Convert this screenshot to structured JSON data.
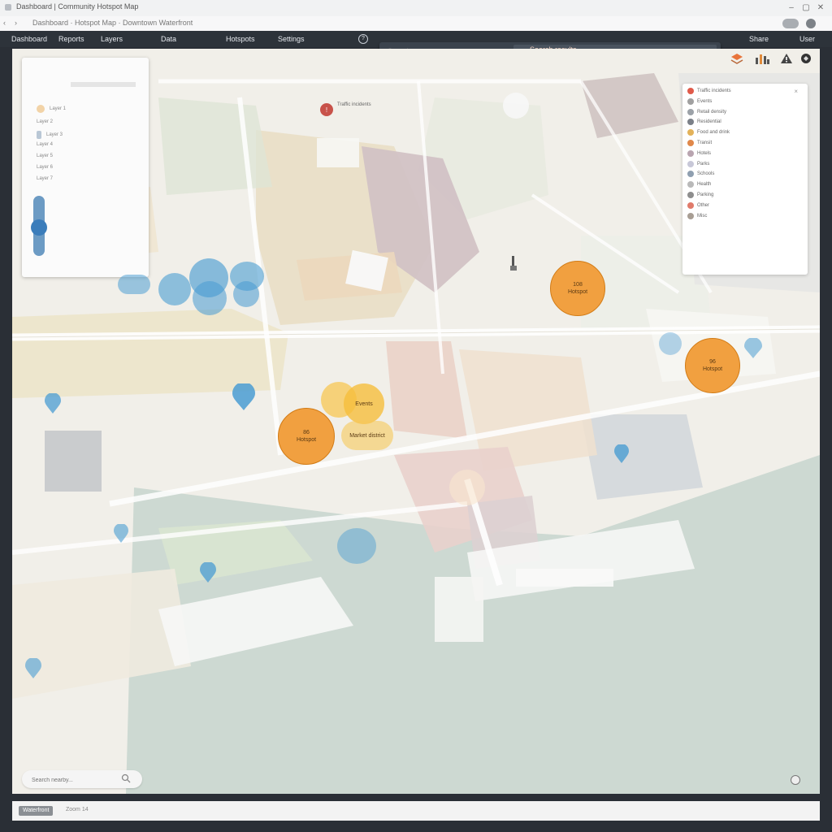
{
  "window": {
    "title": "Dashboard | Community Hotspot Map",
    "controls": [
      "minimize-icon",
      "restore-icon",
      "close-icon"
    ]
  },
  "address_bar": {
    "back": "‹",
    "forward": "›",
    "url": "Dashboard · Hotspot Map · Downtown Waterfront"
  },
  "menu": {
    "items": [
      "Dashboard",
      "Reports",
      "Layers",
      "Data",
      "Hotspots",
      "Settings"
    ],
    "help": "?",
    "right": "Share",
    "user": "User"
  },
  "search": {
    "placeholder": "Search area",
    "query": "Search results"
  },
  "toolbar": {
    "icons": [
      "layers-icon",
      "stats-icon",
      "alert-icon",
      "fullscreen-icon"
    ]
  },
  "layers_panel": {
    "rows": [
      "Layer 1",
      "Layer 2",
      "Layer 3",
      "Layer 4",
      "Layer 5",
      "Layer 6",
      "Layer 7"
    ],
    "slider_value": 0.4
  },
  "legend": {
    "close": "×",
    "items": [
      {
        "label": "Traffic incidents",
        "color": "#e05a4a"
      },
      {
        "label": "Events",
        "color": "#a0a0a0"
      },
      {
        "label": "Retail density",
        "color": "#9ca2a8"
      },
      {
        "label": "Residential",
        "color": "#7b8088"
      },
      {
        "label": "Food and drink",
        "color": "#e3b25a"
      },
      {
        "label": "Transit",
        "color": "#e0884a"
      },
      {
        "label": "Hotels",
        "color": "#b9a5b0"
      },
      {
        "label": "Parks",
        "color": "#c8c8d8"
      },
      {
        "label": "Schools",
        "color": "#8f9fb0"
      },
      {
        "label": "Health",
        "color": "#b9b9b9"
      },
      {
        "label": "Parking",
        "color": "#8e8e8e"
      },
      {
        "label": "Other",
        "color": "#e07b6b"
      },
      {
        "label": "Misc",
        "color": "#a89e94"
      }
    ]
  },
  "clusters": {
    "orange": [
      {
        "value": "86",
        "sub": "Hotspot"
      },
      {
        "value": "108",
        "sub": "Hotspot"
      },
      {
        "value": "96",
        "sub": "Hotspot"
      }
    ],
    "yellow_label": "Events",
    "yellow_sub": "Market district"
  },
  "bottom_search": {
    "placeholder": "Search nearby..."
  },
  "status": {
    "tag": "Waterfront",
    "zoom": "Zoom 14"
  },
  "colors": {
    "accent_orange": "#f1a040",
    "accent_blue": "#4a9cd2",
    "water": "#cdd9d2"
  }
}
